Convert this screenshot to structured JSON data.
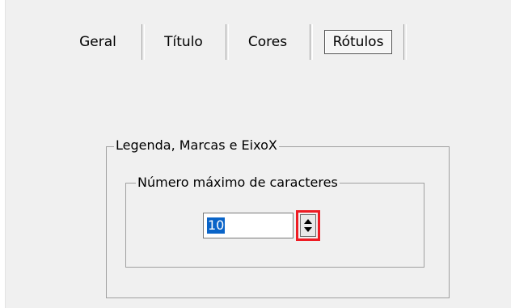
{
  "tabs": [
    {
      "label": "Geral"
    },
    {
      "label": "Título"
    },
    {
      "label": "Cores"
    },
    {
      "label": "Rótulos",
      "selected": true
    }
  ],
  "groups": {
    "outer": {
      "label": "Legenda, Marcas e EixoX"
    },
    "inner": {
      "label": "Número máximo de caracteres"
    }
  },
  "spinner": {
    "value": "10",
    "highlight_color": "#ee1c24"
  },
  "colors": {
    "background": "#f0f0f0",
    "selection": "#0a64c8"
  }
}
